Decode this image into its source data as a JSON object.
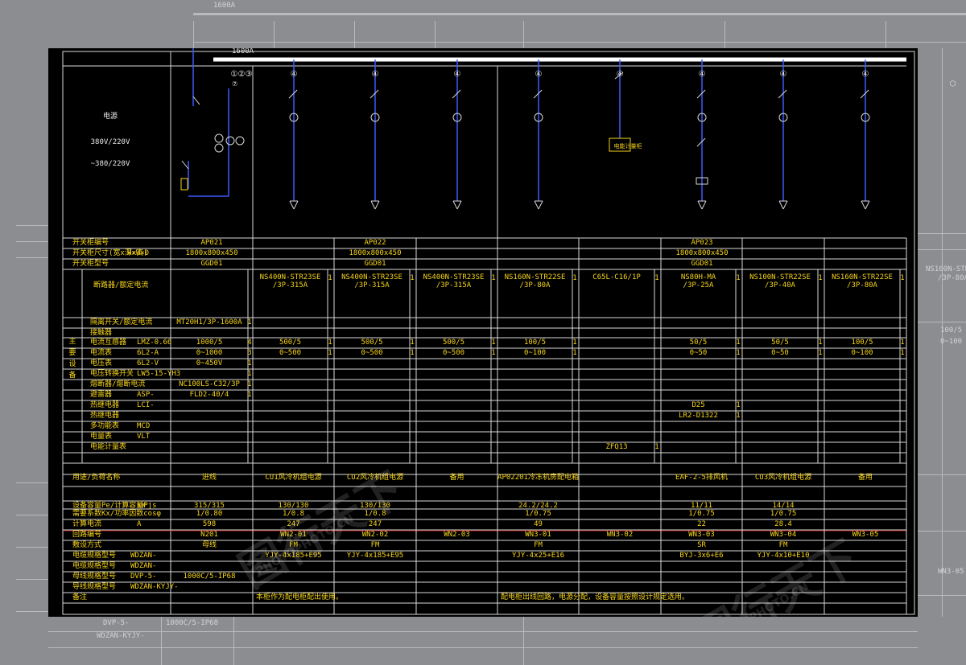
{
  "bus_rating": "1600A",
  "outside_bus_rating": "1600A",
  "left_block": {
    "line1": "电源",
    "line2": "380V/220V",
    "line3": "~380/220V"
  },
  "circuit_numbers": [
    "①②③",
    "④",
    "④",
    "④",
    "④",
    "④",
    "④",
    "④",
    "④"
  ],
  "sub_number": "⑦",
  "unit_label": "电能计量柜",
  "cabinets": [
    {
      "id": "AP021",
      "size": "1800x800x450",
      "model": "GGD01"
    },
    {
      "id": "AP022",
      "size": "1800x800x450",
      "model": "GGD01"
    },
    {
      "id": "AP023",
      "size": "1800x800x450",
      "model": "GGD01"
    }
  ],
  "header_rows": [
    {
      "label": "开关柜编号",
      "unit": ""
    },
    {
      "label": "开关柜尺寸(宽x深x高)",
      "unit": "H×W×D"
    },
    {
      "label": "开关柜型号",
      "unit": ""
    }
  ],
  "breakers": [
    "NS400N-STR23SE\n/3P-315A",
    "NS400N-STR23SE\n/3P-315A",
    "NS400N-STR23SE\n/3P-315A",
    "NS160N-STR22SE\n/3P-80A",
    "C65L-C16/1P",
    "NS80H-MA\n/3P-25A",
    "NS100N-STR22SE\n/3P-40A",
    "NS160N-STR22SE\n/3P-80A"
  ],
  "equipment_group_label": "主要设备",
  "equipment_rows": [
    {
      "label": "断路器/额定电流",
      "type": "",
      "incoming": "",
      "qty": "",
      "cells": [
        "",
        "",
        "",
        "",
        "",
        "",
        "",
        ""
      ]
    },
    {
      "label": "隔离开关/额定电流",
      "type": "",
      "incoming": "MT20H1/3P-1600A",
      "qty": "1",
      "cells": [
        "",
        "",
        "",
        "",
        "",
        "",
        "",
        ""
      ]
    },
    {
      "label": "接触器",
      "type": "",
      "incoming": "",
      "qty": "",
      "cells": [
        "",
        "",
        "",
        "",
        "",
        "",
        "",
        ""
      ]
    },
    {
      "label": "电流互感器",
      "type": "LMZ-0.66",
      "incoming": "1000/5",
      "qty": "4",
      "cells": [
        "500/5",
        "500/5",
        "500/5",
        "100/5",
        "",
        "50/5",
        "50/5",
        "100/5"
      ]
    },
    {
      "label": "电流表",
      "type": "6L2-A",
      "incoming": "0~1000",
      "qty": "3",
      "cells": [
        "0~500",
        "0~500",
        "0~500",
        "0~100",
        "",
        "0~50",
        "0~50",
        "0~100"
      ]
    },
    {
      "label": "电压表",
      "type": "6L2-V",
      "incoming": "0~450V",
      "qty": "1",
      "cells": [
        "",
        "",
        "",
        "",
        "",
        "",
        "",
        ""
      ]
    },
    {
      "label": "电压转换开关",
      "type": "LW5-15-YH3",
      "incoming": "",
      "qty": "1",
      "cells": [
        "",
        "",
        "",
        "",
        "",
        "",
        "",
        ""
      ]
    },
    {
      "label": "熔断器/熔断电流",
      "type": "",
      "incoming": "NC100LS-C32/3P",
      "qty": "1",
      "cells": [
        "",
        "",
        "",
        "",
        "",
        "",
        "",
        ""
      ]
    },
    {
      "label": "避雷器",
      "type": "ASP-",
      "incoming": "FLD2-40/4",
      "qty": "1",
      "cells": [
        "",
        "",
        "",
        "",
        "",
        "",
        "",
        ""
      ]
    },
    {
      "label": "热继电器",
      "type": "LCI-",
      "incoming": "",
      "qty": "",
      "cells": [
        "",
        "",
        "",
        "",
        "",
        "D25",
        "",
        ""
      ]
    },
    {
      "label": "热继电器",
      "type": "",
      "incoming": "",
      "qty": "",
      "cells": [
        "",
        "",
        "",
        "",
        "",
        "LR2-D1322",
        "",
        ""
      ]
    },
    {
      "label": "多功能表",
      "type": "MCD",
      "incoming": "",
      "qty": "",
      "cells": [
        "",
        "",
        "",
        "",
        "",
        "",
        "",
        ""
      ]
    },
    {
      "label": "电量表",
      "type": "VLT",
      "incoming": "",
      "qty": "",
      "cells": [
        "",
        "",
        "",
        "",
        "",
        "",
        "",
        ""
      ]
    },
    {
      "label": "电能计量表",
      "type": "",
      "incoming": "",
      "qty": "",
      "cells": [
        "",
        "",
        "",
        "",
        "ZFQ13",
        "",
        "",
        ""
      ]
    }
  ],
  "loads": {
    "label": "用途/负荷名称",
    "incoming": "进线",
    "cells": [
      "CU1风冷机组电源",
      "CU2风冷机组电源",
      "备用",
      "AP02201冷冻机房配电箱",
      "",
      "EAF-2-5排风机",
      "CU3风冷机组电源",
      "备用"
    ]
  },
  "power_rows": [
    {
      "label": "设备容量Pe/计算容量Pjs",
      "unit": "kW",
      "incoming": "315/315",
      "cells": [
        "130/130",
        "130/130",
        "",
        "24.2/24.2",
        "",
        "11/11",
        "14/14",
        ""
      ]
    },
    {
      "label": "需要系数Kx/功率因数cosφ",
      "unit": "",
      "incoming": "1/0.80",
      "cells": [
        "1/0.8",
        "1/0.8",
        "",
        "1/0.75",
        "",
        "1/0.75",
        "1/0.75",
        ""
      ]
    },
    {
      "label": "计算电流",
      "unit": "A",
      "incoming": "598",
      "cells": [
        "247",
        "247",
        "",
        "49",
        "",
        "22",
        "28.4",
        ""
      ]
    }
  ],
  "circuit_row": {
    "label": "回路编号",
    "incoming": "N201",
    "cells": [
      "WN2-01",
      "WN2-02",
      "WN2-03",
      "WN3-01",
      "WN3-02",
      "WN3-03",
      "WN3-04",
      "WN3-05"
    ]
  },
  "laying_row": {
    "label": "敷设方式",
    "incoming": "母线",
    "cells": [
      "FM",
      "FM",
      "",
      "FM",
      "",
      "SR",
      "FM",
      ""
    ]
  },
  "cable_rows": [
    {
      "label": "电缆规格型号",
      "unit": "WDZAN-",
      "incoming": "",
      "cells": [
        "YJY-4x185+E95",
        "YJY-4x185+E95",
        "",
        "YJY-4x25+E16",
        "",
        "BYJ-3x6+E6",
        "YJY-4x10+E10",
        ""
      ]
    },
    {
      "label": "电缆规格型号",
      "unit": "WDZAN-",
      "incoming": "",
      "cells": [
        "",
        "",
        "",
        "",
        "",
        "",
        "",
        ""
      ]
    },
    {
      "label": "母线规格型号",
      "unit": "DVP-5-",
      "incoming": "1000C/5-IP68",
      "cells": [
        "",
        "",
        "",
        "",
        "",
        "",
        "",
        ""
      ]
    },
    {
      "label": "导线规格型号",
      "unit": "WDZAN-KYJY-",
      "incoming": "",
      "cells": [
        "",
        "",
        "",
        "",
        "",
        "",
        "",
        ""
      ]
    },
    {
      "label": "备注",
      "unit": "",
      "incoming": "",
      "cells": [
        "",
        "",
        "",
        "",
        "",
        "",
        "",
        ""
      ]
    }
  ],
  "notes": [
    "本柜作为配电柜配出使用。",
    "配电柜出线回路，电源分配，设备容量按照设计规定选用。"
  ],
  "outside": {
    "right_label1": "NS160N-STR22",
    "right_label2": "/3P-80A",
    "right_label3": "100/5",
    "right_label4": "0~100",
    "right_label5": "WN3-05",
    "bottom_left1": "DVP-5-",
    "bottom_left2": "WDZAN-KYJY-",
    "bottom_left3": "1000C/5-IP68"
  },
  "watermark": {
    "text1": "图行天下",
    "text2": "PHOTOPHOTO.CN"
  }
}
